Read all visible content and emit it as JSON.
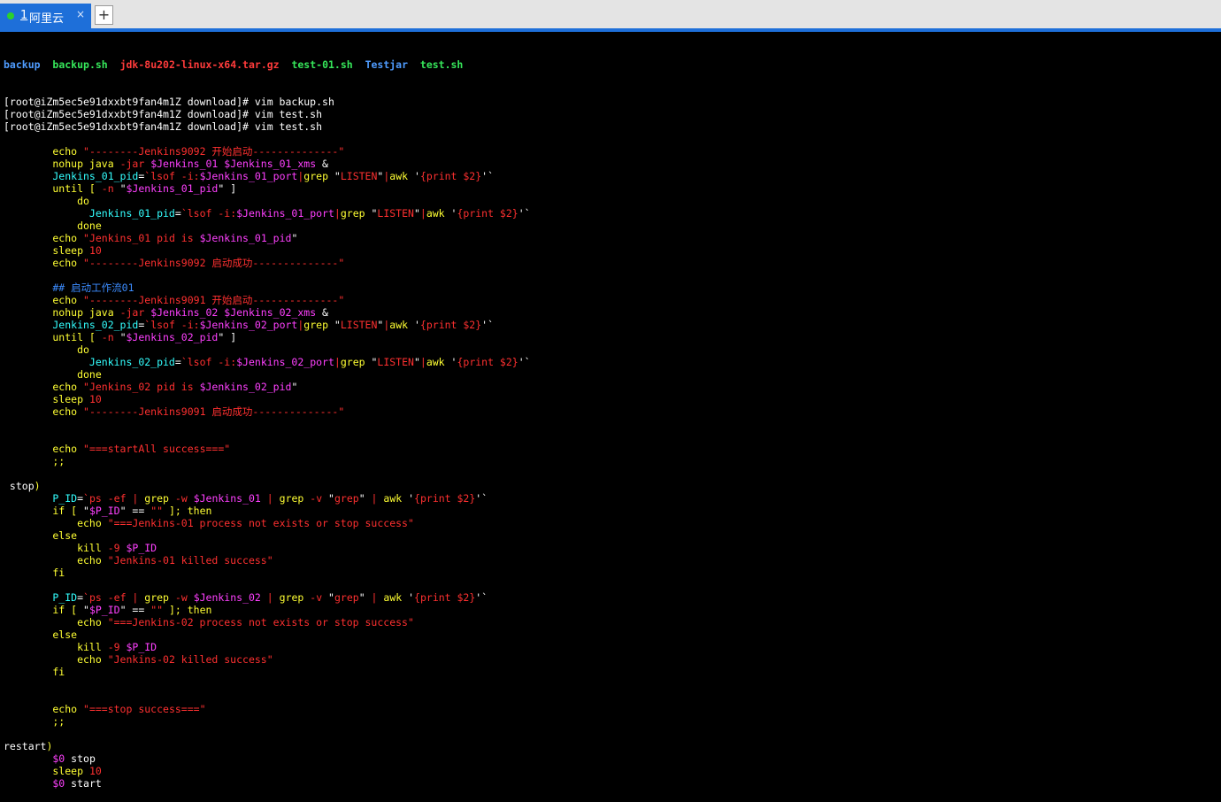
{
  "tab": {
    "number": "1",
    "title": "阿里云",
    "close": "×",
    "add": "+"
  },
  "colors": {
    "tab_active": "#1e6fd9",
    "terminal_bg": "#000000",
    "keyword": "#ffff33",
    "string": "#ff3030",
    "variable": "#ff40ff",
    "identifier": "#33ffff",
    "comment": "#3c8cff",
    "plain": "#ffffff"
  },
  "listing": [
    {
      "name": "backup",
      "kind": "dir"
    },
    {
      "name": "backup.sh",
      "kind": "exe"
    },
    {
      "name": "jdk-8u202-linux-x64.tar.gz",
      "kind": "archive"
    },
    {
      "name": "test-01.sh",
      "kind": "exe"
    },
    {
      "name": "Testjar",
      "kind": "dir"
    },
    {
      "name": "test.sh",
      "kind": "exe"
    }
  ],
  "lines": [
    [
      [
        "[root@iZm5ec5e91dxxbt9fan4m1Z download]# vim backup.sh",
        "w"
      ]
    ],
    [
      [
        "[root@iZm5ec5e91dxxbt9fan4m1Z download]# vim test.sh",
        "w"
      ]
    ],
    [
      [
        "[root@iZm5ec5e91dxxbt9fan4m1Z download]# vim test.sh",
        "w"
      ]
    ],
    [],
    [
      [
        "        echo ",
        "y"
      ],
      [
        "\"--------Jenkins9092 开始启动--------------\"",
        "r"
      ]
    ],
    [
      [
        "        nohup java ",
        "y"
      ],
      [
        "-jar ",
        "r"
      ],
      [
        "$Jenkins_01 $Jenkins_01_xms",
        "m"
      ],
      [
        " &",
        "w"
      ]
    ],
    [
      [
        "        Jenkins_01_pid",
        "c"
      ],
      [
        "=",
        "w"
      ],
      [
        "`lsof -i:",
        "r"
      ],
      [
        "$Jenkins_01_port",
        "m"
      ],
      [
        "|",
        "r"
      ],
      [
        "grep ",
        "y"
      ],
      [
        "\"",
        "w"
      ],
      [
        "LISTEN",
        "r"
      ],
      [
        "\"",
        "w"
      ],
      [
        "|",
        "r"
      ],
      [
        "awk ",
        "y"
      ],
      [
        "'",
        "w"
      ],
      [
        "{print $2}",
        "r"
      ],
      [
        "'`",
        "w"
      ]
    ],
    [
      [
        "        until [ ",
        "y"
      ],
      [
        "-n ",
        "r"
      ],
      [
        "\"",
        "w"
      ],
      [
        "$Jenkins_01_pid",
        "m"
      ],
      [
        "\" ]",
        "w"
      ]
    ],
    [
      [
        "            do",
        "y"
      ]
    ],
    [
      [
        "              Jenkins_01_pid",
        "c"
      ],
      [
        "=",
        "w"
      ],
      [
        "`lsof -i:",
        "r"
      ],
      [
        "$Jenkins_01_port",
        "m"
      ],
      [
        "|",
        "r"
      ],
      [
        "grep ",
        "y"
      ],
      [
        "\"",
        "w"
      ],
      [
        "LISTEN",
        "r"
      ],
      [
        "\"",
        "w"
      ],
      [
        "|",
        "r"
      ],
      [
        "awk ",
        "y"
      ],
      [
        "'",
        "w"
      ],
      [
        "{print $2}",
        "r"
      ],
      [
        "'`",
        "w"
      ]
    ],
    [
      [
        "            done",
        "y"
      ]
    ],
    [
      [
        "        echo ",
        "y"
      ],
      [
        "\"Jenkins_01 pid is ",
        "r"
      ],
      [
        "$Jenkins_01_pid",
        "m"
      ],
      [
        "\"",
        "w"
      ]
    ],
    [
      [
        "        sleep ",
        "y"
      ],
      [
        "10",
        "r"
      ]
    ],
    [
      [
        "        echo ",
        "y"
      ],
      [
        "\"--------Jenkins9092 启动成功--------------\"",
        "r"
      ]
    ],
    [],
    [
      [
        "        ## 启动工作流01",
        "b"
      ]
    ],
    [
      [
        "        echo ",
        "y"
      ],
      [
        "\"--------Jenkins9091 开始启动--------------\"",
        "r"
      ]
    ],
    [
      [
        "        nohup java ",
        "y"
      ],
      [
        "-jar ",
        "r"
      ],
      [
        "$Jenkins_02 $Jenkins_02_xms",
        "m"
      ],
      [
        " &",
        "w"
      ]
    ],
    [
      [
        "        Jenkins_02_pid",
        "c"
      ],
      [
        "=",
        "w"
      ],
      [
        "`lsof -i:",
        "r"
      ],
      [
        "$Jenkins_02_port",
        "m"
      ],
      [
        "|",
        "r"
      ],
      [
        "grep ",
        "y"
      ],
      [
        "\"",
        "w"
      ],
      [
        "LISTEN",
        "r"
      ],
      [
        "\"",
        "w"
      ],
      [
        "|",
        "r"
      ],
      [
        "awk ",
        "y"
      ],
      [
        "'",
        "w"
      ],
      [
        "{print $2}",
        "r"
      ],
      [
        "'`",
        "w"
      ]
    ],
    [
      [
        "        until [ ",
        "y"
      ],
      [
        "-n ",
        "r"
      ],
      [
        "\"",
        "w"
      ],
      [
        "$Jenkins_02_pid",
        "m"
      ],
      [
        "\" ]",
        "w"
      ]
    ],
    [
      [
        "            do",
        "y"
      ]
    ],
    [
      [
        "              Jenkins_02_pid",
        "c"
      ],
      [
        "=",
        "w"
      ],
      [
        "`lsof -i:",
        "r"
      ],
      [
        "$Jenkins_02_port",
        "m"
      ],
      [
        "|",
        "r"
      ],
      [
        "grep ",
        "y"
      ],
      [
        "\"",
        "w"
      ],
      [
        "LISTEN",
        "r"
      ],
      [
        "\"",
        "w"
      ],
      [
        "|",
        "r"
      ],
      [
        "awk ",
        "y"
      ],
      [
        "'",
        "w"
      ],
      [
        "{print $2}",
        "r"
      ],
      [
        "'`",
        "w"
      ]
    ],
    [
      [
        "            done",
        "y"
      ]
    ],
    [
      [
        "        echo ",
        "y"
      ],
      [
        "\"Jenkins_02 pid is ",
        "r"
      ],
      [
        "$Jenkins_02_pid",
        "m"
      ],
      [
        "\"",
        "w"
      ]
    ],
    [
      [
        "        sleep ",
        "y"
      ],
      [
        "10",
        "r"
      ]
    ],
    [
      [
        "        echo ",
        "y"
      ],
      [
        "\"--------Jenkins9091 启动成功--------------\"",
        "r"
      ]
    ],
    [],
    [],
    [
      [
        "        echo ",
        "y"
      ],
      [
        "\"===startAll success===\"",
        "r"
      ]
    ],
    [
      [
        "        ;;",
        "y"
      ]
    ],
    [],
    [
      [
        " stop",
        "w"
      ],
      [
        ")",
        "y"
      ]
    ],
    [
      [
        "        P_ID",
        "c"
      ],
      [
        "=",
        "w"
      ],
      [
        "`ps -ef | ",
        "r"
      ],
      [
        "grep ",
        "y"
      ],
      [
        "-w ",
        "r"
      ],
      [
        "$Jenkins_01",
        "m"
      ],
      [
        " | ",
        "r"
      ],
      [
        "grep ",
        "y"
      ],
      [
        "-v ",
        "r"
      ],
      [
        "\"",
        "w"
      ],
      [
        "grep",
        "r"
      ],
      [
        "\" ",
        "w"
      ],
      [
        "| ",
        "r"
      ],
      [
        "awk ",
        "y"
      ],
      [
        "'",
        "w"
      ],
      [
        "{print $2}",
        "r"
      ],
      [
        "'`",
        "w"
      ]
    ],
    [
      [
        "        if [ ",
        "y"
      ],
      [
        "\"",
        "w"
      ],
      [
        "$P_ID",
        "m"
      ],
      [
        "\" == ",
        "w"
      ],
      [
        "\"\"",
        "r"
      ],
      [
        " ]; then",
        "y"
      ]
    ],
    [
      [
        "            echo ",
        "y"
      ],
      [
        "\"===Jenkins-01 process not exists or stop success\"",
        "r"
      ]
    ],
    [
      [
        "        else",
        "y"
      ]
    ],
    [
      [
        "            kill ",
        "y"
      ],
      [
        "-9 ",
        "r"
      ],
      [
        "$P_ID",
        "m"
      ]
    ],
    [
      [
        "            echo ",
        "y"
      ],
      [
        "\"Jenkins-01 killed success\"",
        "r"
      ]
    ],
    [
      [
        "        fi",
        "y"
      ]
    ],
    [],
    [
      [
        "        P_ID",
        "c"
      ],
      [
        "=",
        "w"
      ],
      [
        "`ps -ef | ",
        "r"
      ],
      [
        "grep ",
        "y"
      ],
      [
        "-w ",
        "r"
      ],
      [
        "$Jenkins_02",
        "m"
      ],
      [
        " | ",
        "r"
      ],
      [
        "grep ",
        "y"
      ],
      [
        "-v ",
        "r"
      ],
      [
        "\"",
        "w"
      ],
      [
        "grep",
        "r"
      ],
      [
        "\" ",
        "w"
      ],
      [
        "| ",
        "r"
      ],
      [
        "awk ",
        "y"
      ],
      [
        "'",
        "w"
      ],
      [
        "{print $2}",
        "r"
      ],
      [
        "'`",
        "w"
      ]
    ],
    [
      [
        "        if [ ",
        "y"
      ],
      [
        "\"",
        "w"
      ],
      [
        "$P_ID",
        "m"
      ],
      [
        "\" == ",
        "w"
      ],
      [
        "\"\"",
        "r"
      ],
      [
        " ]; then",
        "y"
      ]
    ],
    [
      [
        "            echo ",
        "y"
      ],
      [
        "\"===Jenkins-02 process not exists or stop success\"",
        "r"
      ]
    ],
    [
      [
        "        else",
        "y"
      ]
    ],
    [
      [
        "            kill ",
        "y"
      ],
      [
        "-9 ",
        "r"
      ],
      [
        "$P_ID",
        "m"
      ]
    ],
    [
      [
        "            echo ",
        "y"
      ],
      [
        "\"Jenkins-02 killed success\"",
        "r"
      ]
    ],
    [
      [
        "        fi",
        "y"
      ]
    ],
    [],
    [],
    [
      [
        "        echo ",
        "y"
      ],
      [
        "\"===stop success===\"",
        "r"
      ]
    ],
    [
      [
        "        ;;",
        "y"
      ]
    ],
    [],
    [
      [
        "restart",
        "w"
      ],
      [
        ")",
        "y"
      ]
    ],
    [
      [
        "        $0 ",
        "m"
      ],
      [
        "stop",
        "w"
      ]
    ],
    [
      [
        "        sleep ",
        "y"
      ],
      [
        "10",
        "r"
      ]
    ],
    [
      [
        "        $0 ",
        "m"
      ],
      [
        "start",
        "w"
      ]
    ]
  ]
}
